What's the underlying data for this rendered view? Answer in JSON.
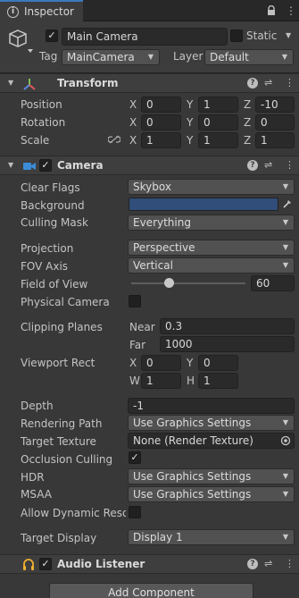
{
  "tab": {
    "title": "Inspector"
  },
  "object": {
    "enabled": true,
    "name": "Main Camera",
    "static_label": "Static",
    "static_checked": false,
    "tag_label": "Tag",
    "tag_value": "MainCamera",
    "layer_label": "Layer",
    "layer_value": "Default"
  },
  "transform": {
    "title": "Transform",
    "rows": [
      {
        "label": "Position",
        "x": "0",
        "y": "1",
        "z": "-10"
      },
      {
        "label": "Rotation",
        "x": "0",
        "y": "0",
        "z": "0"
      },
      {
        "label": "Scale",
        "x": "1",
        "y": "1",
        "z": "1"
      }
    ],
    "axis": {
      "x": "X",
      "y": "Y",
      "z": "Z"
    }
  },
  "camera": {
    "title": "Camera",
    "enabled": true,
    "background_color": "#314d79",
    "clear_flags_label": "Clear Flags",
    "clear_flags_value": "Skybox",
    "background_label": "Background",
    "culling_mask_label": "Culling Mask",
    "culling_mask_value": "Everything",
    "projection_label": "Projection",
    "projection_value": "Perspective",
    "fov_axis_label": "FOV Axis",
    "fov_axis_value": "Vertical",
    "fov_label": "Field of View",
    "fov_value": "60",
    "fov_slider_fraction": 0.33,
    "physical_label": "Physical Camera",
    "physical_checked": false,
    "clipping_label": "Clipping Planes",
    "near_label": "Near",
    "near_value": "0.3",
    "far_label": "Far",
    "far_value": "1000",
    "viewport_label": "Viewport Rect",
    "vp_x_label": "X",
    "vp_x": "0",
    "vp_y_label": "Y",
    "vp_y": "0",
    "vp_w_label": "W",
    "vp_w": "1",
    "vp_h_label": "H",
    "vp_h": "1",
    "depth_label": "Depth",
    "depth_value": "-1",
    "rendering_path_label": "Rendering Path",
    "rendering_path_value": "Use Graphics Settings",
    "target_texture_label": "Target Texture",
    "target_texture_value": "None (Render Texture)",
    "occlusion_label": "Occlusion Culling",
    "occlusion_checked": true,
    "hdr_label": "HDR",
    "hdr_value": "Use Graphics Settings",
    "msaa_label": "MSAA",
    "msaa_value": "Use Graphics Settings",
    "dynres_label": "Allow Dynamic Resol",
    "dynres_checked": false,
    "target_display_label": "Target Display",
    "target_display_value": "Display 1"
  },
  "audio_listener": {
    "title": "Audio Listener",
    "enabled": true
  },
  "add_component_label": "Add Component",
  "icons": {
    "info": "i",
    "lock": "lock-icon",
    "menu": "⋮",
    "help": "?",
    "presets": "⇌",
    "checkmark": "✓",
    "dropdown_arrow": "▼",
    "fold_arrow": "▼"
  }
}
